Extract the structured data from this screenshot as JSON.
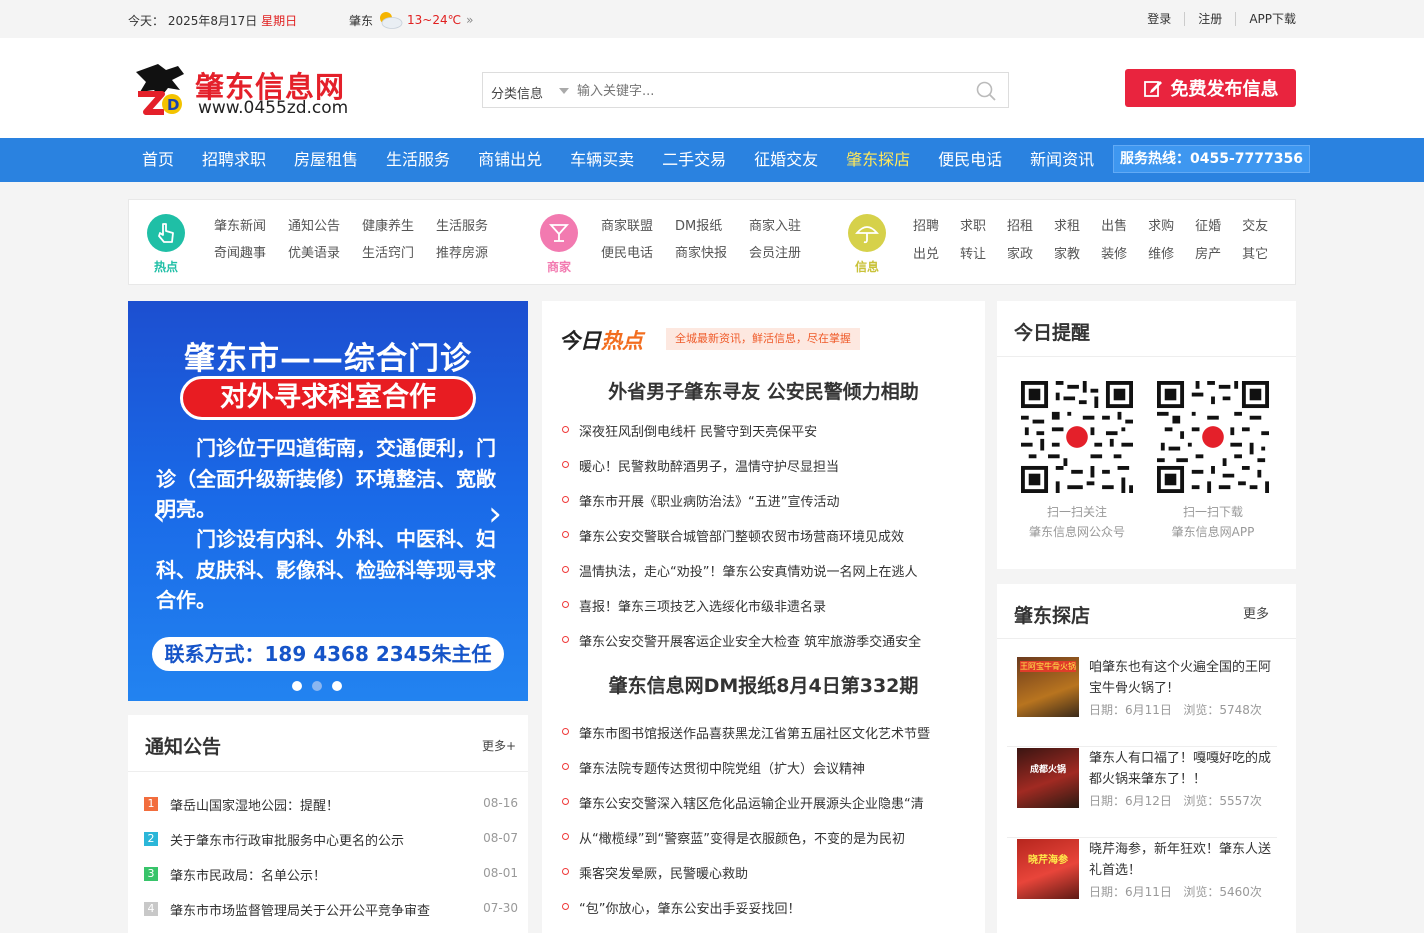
{
  "topbar": {
    "today_label": "今天：",
    "date": "2025年8月17日",
    "weekday": "星期日",
    "weather_city": "肇东",
    "weather_temp": "13~24℃",
    "weather_more": "»",
    "login": "登录",
    "register": "注册",
    "app_download": "APP下载"
  },
  "header": {
    "logo_name": "肇东信息网",
    "logo_url": "www.0455zd.com",
    "search_category": "分类信息",
    "search_placeholder": "输入关键字...",
    "publish_button": "免费发布信息"
  },
  "nav": {
    "items": [
      "首页",
      "招聘求职",
      "房屋租售",
      "生活服务",
      "商铺出兑",
      "车辆买卖",
      "二手交易",
      "征婚交友",
      "肇东探店",
      "便民电话",
      "新闻资讯"
    ],
    "highlighted": "肇东探店",
    "hotline": "服务热线：0455-7777356"
  },
  "categories": {
    "hot_label": "热点",
    "hot_items": [
      "肇东新闻",
      "通知公告",
      "健康养生",
      "生活服务",
      "奇闻趣事",
      "优美语录",
      "生活窍门",
      "推荐房源"
    ],
    "shop_label": "商家",
    "shop_items": [
      "商家联盟",
      "DM报纸",
      "商家入驻",
      "便民电话",
      "商家快报",
      "会员注册"
    ],
    "info_label": "信息",
    "info_items": [
      "招聘",
      "求职",
      "招租",
      "求租",
      "出售",
      "求购",
      "征婚",
      "交友",
      "出兑",
      "转让",
      "家政",
      "家教",
      "装修",
      "维修",
      "房产",
      "其它"
    ]
  },
  "banner": {
    "title": "肇东市——综合门诊",
    "pill": "对外寻求科室合作",
    "para1": "　　门诊位于四道街南，交通便利，门诊（全面升级新装修）环境整洁、宽敞明亮。",
    "para2": "　　门诊设有内科、外科、中医科、妇科、皮肤科、影像科、检验科等现寻求合作。",
    "contact": "联系方式：189 4368 2345朱主任",
    "prev": "‹",
    "next": "›"
  },
  "notice": {
    "title": "通知公告",
    "more": "更多+",
    "items": [
      {
        "num": "1",
        "text": "肇岳山国家湿地公园：提醒！",
        "date": "08-16",
        "color": "#f26d3d"
      },
      {
        "num": "2",
        "text": "关于肇东市行政审批服务中心更名的公示",
        "date": "08-07",
        "color": "#2bb6d8"
      },
      {
        "num": "3",
        "text": "肇东市民政局：名单公示！",
        "date": "08-01",
        "color": "#38c46a"
      },
      {
        "num": "4",
        "text": "肇东市市场监督管理局关于公开公平竞争审查",
        "date": "07-30",
        "color": "#c8c8c8"
      }
    ]
  },
  "hot": {
    "logo_a": "今日",
    "logo_b": "热点",
    "tag": "全城最新资讯，鲜活信息，尽在掌握",
    "headline1": "外省男子肇东寻友 公安民警倾力相助",
    "list1": [
      "深夜狂风刮倒电线杆 民警守到天亮保平安",
      "暖心！民警救助醉酒男子，温情守护尽显担当",
      "肇东市开展《职业病防治法》“五进”宣传活动",
      "肇东公安交警联合城管部门整顿农贸市场营商环境见成效",
      "温情执法，走心“劝投”！肇东公安真情劝说一名网上在逃人",
      "喜报！肇东三项技艺入选绥化市级非遗名录",
      "肇东公安交警开展客运企业安全大检查 筑牢旅游季交通安全"
    ],
    "headline2": "肇东信息网DM报纸8月4日第332期",
    "list2": [
      "肇东市图书馆报送作品喜获黑龙江省第五届社区文化艺术节暨",
      "肇东法院专题传达贯彻中院党组（扩大）会议精神",
      "肇东公安交警深入辖区危化品运输企业开展源头企业隐患“清",
      "从“橄榄绿”到“警察蓝”变得是衣服颜色，不变的是为民初",
      "乘客突发晕厥，民警暖心救助",
      "“包”你放心，肇东公安出手妥妥找回！"
    ]
  },
  "remind": {
    "title": "今日提醒",
    "qr1_line1": "扫一扫关注",
    "qr1_line2": "肇东信息网公众号",
    "qr2_line1": "扫一扫下载",
    "qr2_line2": "肇东信息网APP"
  },
  "tandian": {
    "title": "肇东探店",
    "more": "更多",
    "date_label": "日期：",
    "views_label": "浏览：",
    "items": [
      {
        "title": "咱肇东也有这个火遍全国的王阿宝牛骨火锅了!",
        "date": "6月11日",
        "views": "5748次",
        "thumb_text": "王阿宝牛骨火锅"
      },
      {
        "title": "肇东人有口福了！嘎嘎好吃的成都火锅来肇东了！！",
        "date": "6月12日",
        "views": "5557次",
        "thumb_text": "成都火锅"
      },
      {
        "title": "晓芹海参，新年狂欢！肇东人送礼首选！",
        "date": "6月11日",
        "views": "5460次",
        "thumb_text": "晓芹海参"
      }
    ]
  }
}
